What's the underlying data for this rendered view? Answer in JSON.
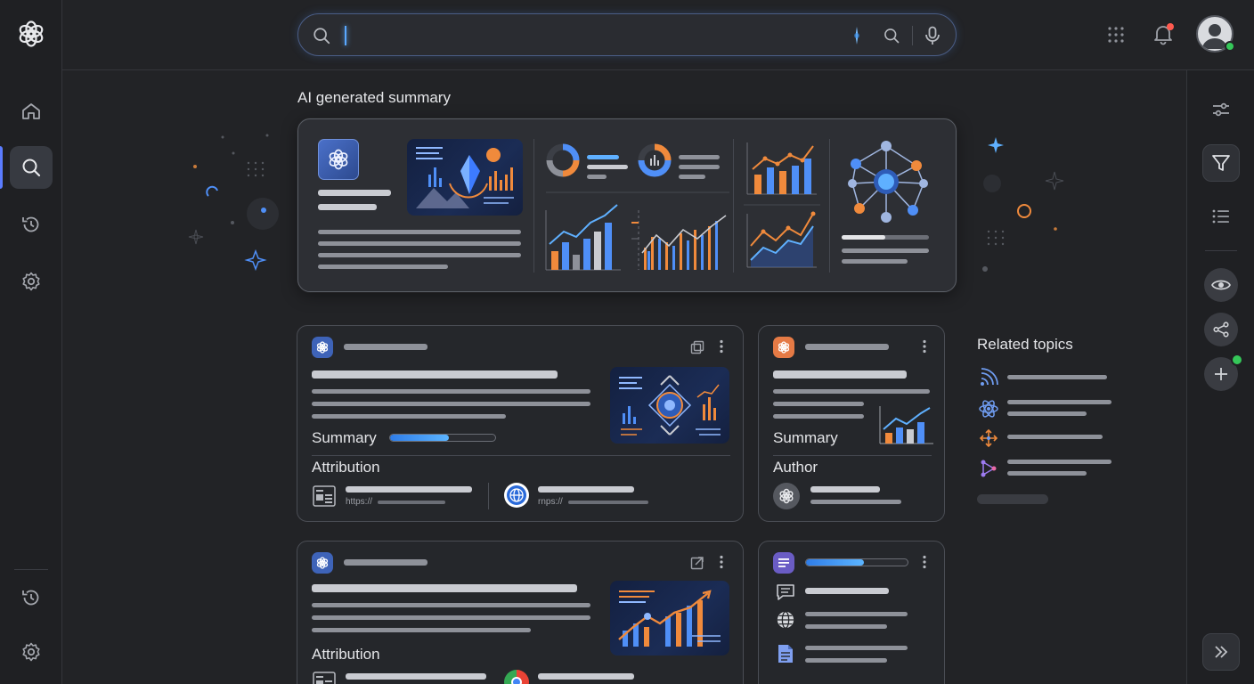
{
  "search": {
    "value": "",
    "placeholder": ""
  },
  "summary_section": {
    "heading": "AI generated summary"
  },
  "card1": {
    "summary_label": "Summary",
    "summary_progress": 0.56,
    "attribution_label": "Attribution",
    "link1_prefix": "https://",
    "link2_prefix": "rnps://"
  },
  "card2": {
    "summary_label": "Summary",
    "author_label": "Author"
  },
  "card3": {
    "attribution_label": "Attribution"
  },
  "card4": {
    "progress": 0.57
  },
  "related": {
    "title": "Related topics"
  },
  "colors": {
    "accent_blue": "#4f8ff7",
    "accent_orange": "#f08a3c",
    "status_green": "#35c759",
    "notification_red": "#ff5a4f"
  },
  "icons": {
    "left_rail": [
      "logo-icon",
      "home-icon",
      "search-icon",
      "history-icon",
      "gear-icon",
      "history-icon",
      "gear-icon"
    ],
    "top_right": [
      "apps-grid-icon",
      "bell-icon",
      "avatar"
    ],
    "right_rail": [
      "sliders-icon",
      "filter-icon",
      "list-icon",
      "eye-icon",
      "share-icon",
      "plus-icon",
      "chevrons-right-icon"
    ],
    "related_topics": [
      "feed-icon",
      "atom-icon",
      "move-icon",
      "graph-icon"
    ]
  }
}
